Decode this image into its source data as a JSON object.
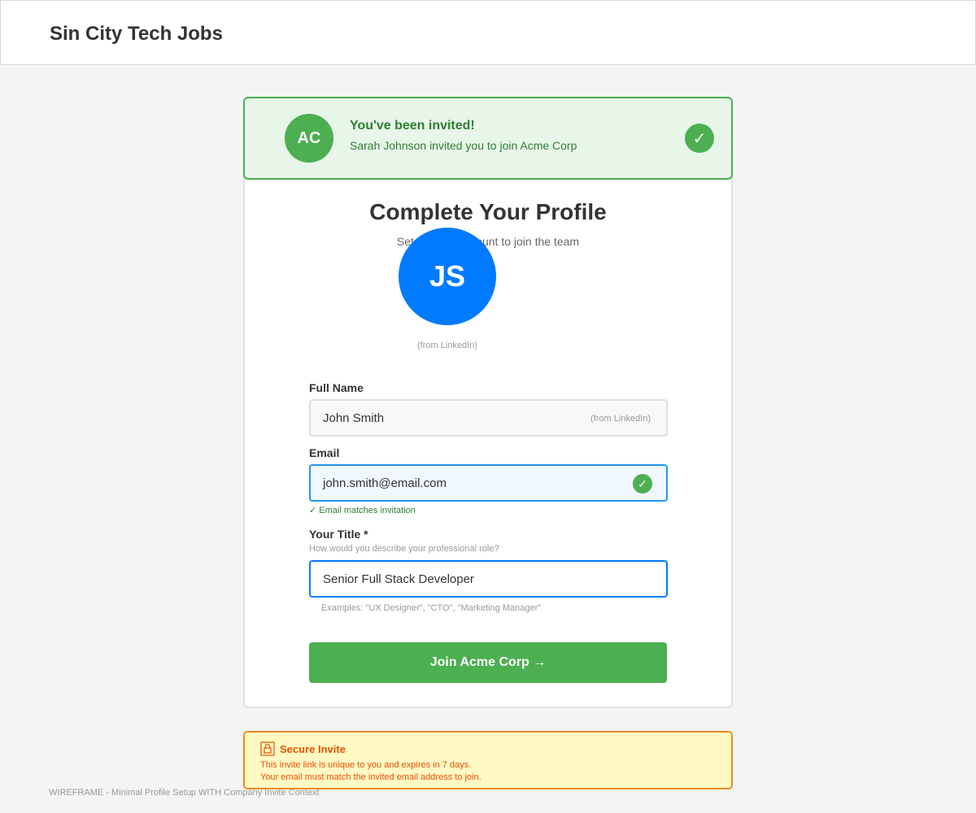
{
  "header": {
    "title": "Sin City Tech Jobs"
  },
  "invite": {
    "company_initials": "AC",
    "heading": "You've been invited!",
    "message": "Sarah Johnson invited you to join Acme Corp",
    "check_icon": "✓"
  },
  "profile": {
    "title": "Complete Your Profile",
    "subtitle": "Set up your account to join the team",
    "avatar_initials": "JS",
    "avatar_source": "(from LinkedIn)"
  },
  "fields": {
    "full_name": {
      "label": "Full Name",
      "value": "John Smith",
      "source": "(from LinkedIn)"
    },
    "email": {
      "label": "Email",
      "value": "john.smith@email.com",
      "check_icon": "✓",
      "status": "✓ Email matches invitation"
    },
    "job_title": {
      "label": "Your Title *",
      "help": "How would you describe your professional role?",
      "value": "Senior Full Stack Developer",
      "examples": "Examples: \"UX Designer\", \"CTO\", \"Marketing Manager\""
    }
  },
  "actions": {
    "join_label": "Join Acme Corp →"
  },
  "security": {
    "icon": "lock-icon",
    "title": "Secure Invite",
    "line1": "This invite link is unique to you and expires in 7 days.",
    "line2": "Your email must match the invited email address to join."
  },
  "footer": {
    "note": "WIREFRAME - Minimal Profile Setup WITH Company Invite Context"
  },
  "colors": {
    "success": "#4caf50",
    "success_text": "#2e7d32",
    "primary": "#007bff",
    "warning_bg": "#fff9c4",
    "warning_text": "#e65100"
  }
}
